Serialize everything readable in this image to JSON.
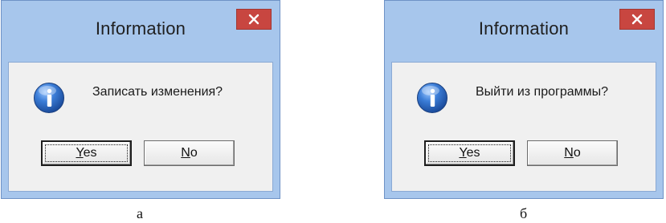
{
  "dialogs": [
    {
      "title": "Information",
      "message": "Записать изменения?",
      "icon": "information-icon",
      "buttons": {
        "yes": {
          "accel": "Y",
          "rest": "es"
        },
        "no": {
          "accel": "N",
          "rest": "o"
        }
      },
      "focused_button": "yes"
    },
    {
      "title": "Information",
      "message": "Выйти из программы?",
      "icon": "information-icon",
      "buttons": {
        "yes": {
          "accel": "Y",
          "rest": "es"
        },
        "no": {
          "accel": "N",
          "rest": "o"
        }
      },
      "focused_button": "yes"
    }
  ],
  "captions": [
    "а",
    "б"
  ],
  "colors": {
    "frame": "#a7c6ec",
    "close_button": "#c84640",
    "client_background": "#f0f0f0",
    "info_icon": "#2a67c0"
  }
}
